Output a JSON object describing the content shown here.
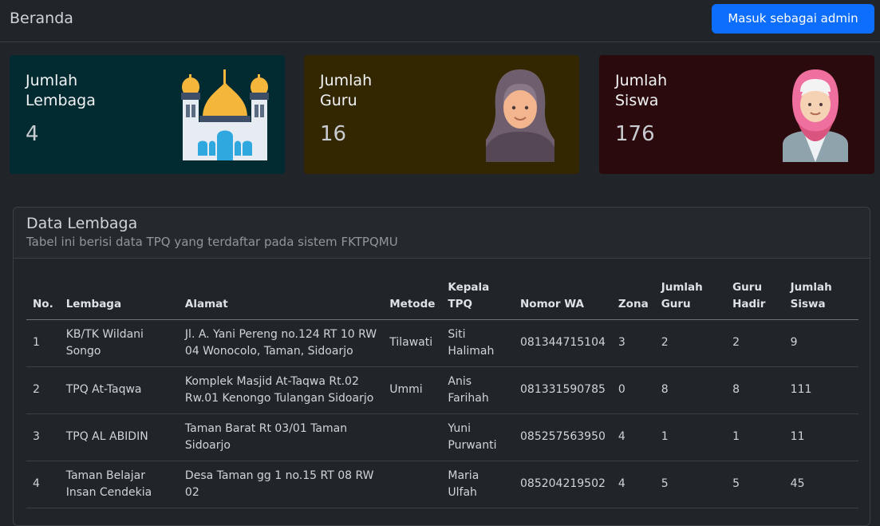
{
  "header": {
    "title": "Beranda",
    "admin_button": "Masuk sebagai admin"
  },
  "stats": [
    {
      "label": "Jumlah Lembaga",
      "value": "4",
      "icon": "mosque-icon",
      "bg": "#012b31"
    },
    {
      "label": "Jumlah Guru",
      "value": "16",
      "icon": "hijab-woman-icon",
      "bg": "#332701"
    },
    {
      "label": "Jumlah Siswa",
      "value": "176",
      "icon": "hijab-girl-icon",
      "bg": "#2b0a0d"
    }
  ],
  "panel": {
    "title": "Data Lembaga",
    "subtitle": "Tabel ini berisi data TPQ yang terdaftar pada sistem FKTPQMU"
  },
  "table": {
    "headers": [
      "No.",
      "Lembaga",
      "Alamat",
      "Metode",
      "Kepala TPQ",
      "Nomor WA",
      "Zona",
      "Jumlah Guru",
      "Guru Hadir",
      "Jumlah Siswa"
    ],
    "rows": [
      [
        "1",
        "KB/TK Wildani Songo",
        "Jl. A. Yani Pereng no.124 RT 10 RW 04 Wonocolo, Taman, Sidoarjo",
        "Tilawati",
        "Siti Halimah",
        "081344715104",
        "3",
        "2",
        "2",
        "9"
      ],
      [
        "2",
        "TPQ At-Taqwa",
        "Komplek Masjid At-Taqwa Rt.02 Rw.01 Kenongo Tulangan Sidoarjo",
        "Ummi",
        "Anis Farihah",
        "081331590785",
        "0",
        "8",
        "8",
        "111"
      ],
      [
        "3",
        "TPQ AL ABIDIN",
        "Taman Barat Rt 03/01 Taman Sidoarjo",
        "",
        "Yuni Purwanti",
        "085257563950",
        "4",
        "1",
        "1",
        "11"
      ],
      [
        "4",
        "Taman Belajar Insan Cendekia",
        "Desa Taman gg 1 no.15 RT 08 RW 02",
        "",
        "Maria Ulfah",
        "085204219502",
        "4",
        "5",
        "5",
        "45"
      ]
    ]
  }
}
